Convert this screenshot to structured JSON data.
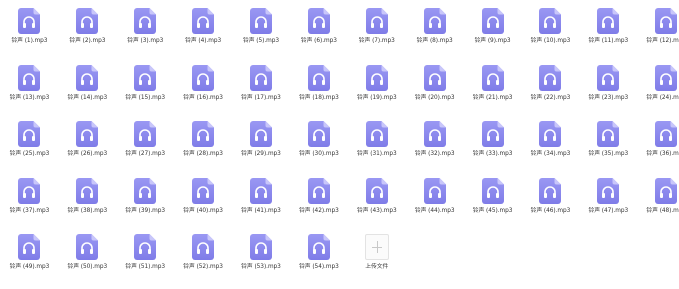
{
  "colors": {
    "icon_top": "#9a98f3",
    "icon_bottom": "#7f7ce8",
    "icon_fold": "#c8c6fa",
    "headphone": "#ffffff",
    "label": "#333333"
  },
  "file_icon_name": "audio-file-icon",
  "files": [
    "铃声 (1).mp3",
    "铃声 (2).mp3",
    "铃声 (3).mp3",
    "铃声 (4).mp3",
    "铃声 (5).mp3",
    "铃声 (6).mp3",
    "铃声 (7).mp3",
    "铃声 (8).mp3",
    "铃声 (9).mp3",
    "铃声 (10).mp3",
    "铃声 (11).mp3",
    "铃声 (12).mp3",
    "铃声 (13).mp3",
    "铃声 (14).mp3",
    "铃声 (15).mp3",
    "铃声 (16).mp3",
    "铃声 (17).mp3",
    "铃声 (18).mp3",
    "铃声 (19).mp3",
    "铃声 (20).mp3",
    "铃声 (21).mp3",
    "铃声 (22).mp3",
    "铃声 (23).mp3",
    "铃声 (24).mp3",
    "铃声 (25).mp3",
    "铃声 (26).mp3",
    "铃声 (27).mp3",
    "铃声 (28).mp3",
    "铃声 (29).mp3",
    "铃声 (30).mp3",
    "铃声 (31).mp3",
    "铃声 (32).mp3",
    "铃声 (33).mp3",
    "铃声 (34).mp3",
    "铃声 (35).mp3",
    "铃声 (36).mp3",
    "铃声 (37).mp3",
    "铃声 (38).mp3",
    "铃声 (39).mp3",
    "铃声 (40).mp3",
    "铃声 (41).mp3",
    "铃声 (42).mp3",
    "铃声 (43).mp3",
    "铃声 (44).mp3",
    "铃声 (45).mp3",
    "铃声 (46).mp3",
    "铃声 (47).mp3",
    "铃声 (48).mp3",
    "铃声 (49).mp3",
    "铃声 (50).mp3",
    "铃声 (51).mp3",
    "铃声 (52).mp3",
    "铃声 (53).mp3",
    "铃声 (54).mp3"
  ],
  "upload": {
    "label": "上传文件",
    "icon": "plus-icon"
  }
}
